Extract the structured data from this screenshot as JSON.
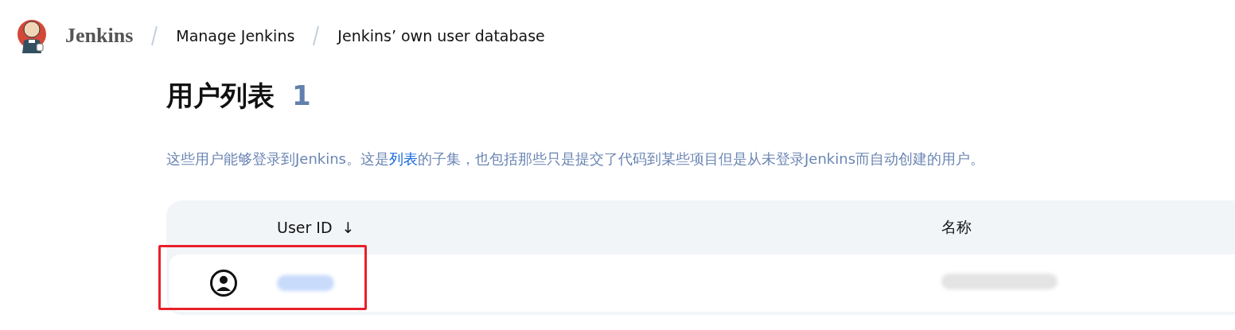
{
  "breadcrumb": {
    "brand": "Jenkins",
    "items": [
      {
        "label": "Manage Jenkins"
      },
      {
        "label": "Jenkins’ own user database"
      }
    ]
  },
  "heading": {
    "title": "用户列表",
    "count": "1"
  },
  "description": {
    "before": "这些用户能够登录到Jenkins。这是",
    "link": "列表",
    "after": "的子集，也包括那些只是提交了代码到某些项目但是从未登录Jenkins而自动创建的用户。"
  },
  "table": {
    "columns": [
      {
        "label": "User ID",
        "sort": "↓"
      },
      {
        "label": "名称"
      }
    ],
    "rows": [
      {
        "highlighted": true
      }
    ]
  }
}
